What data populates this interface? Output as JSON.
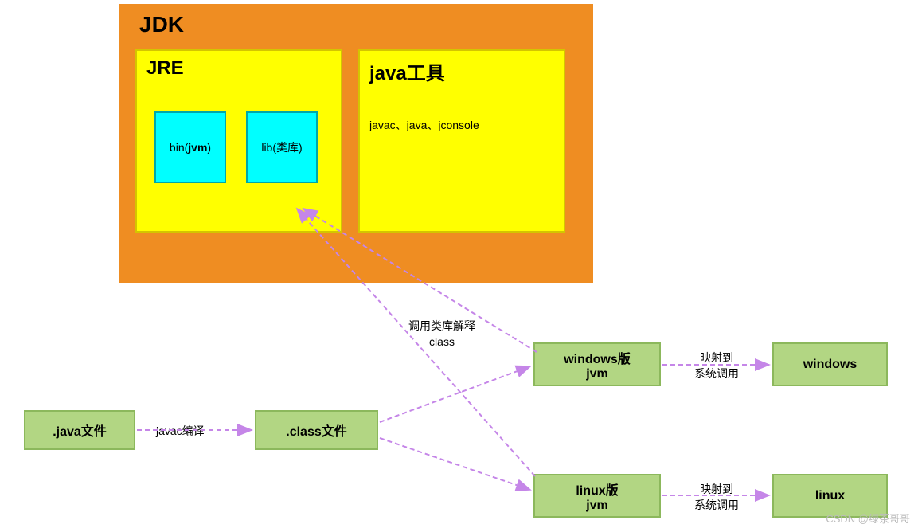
{
  "jdk": {
    "title": "JDK",
    "jre": {
      "title": "JRE",
      "bin_prefix": "bin(",
      "bin_bold": "jvm",
      "bin_suffix": ")",
      "lib": "lib(类库)"
    },
    "tools": {
      "title": "java工具",
      "list": "javac、java、jconsole"
    }
  },
  "labels": {
    "call_lib": "调用类库解释\nclass",
    "javac": "javac编译",
    "map_sys1": "映射到\n系统调用",
    "map_sys2": "映射到\n系统调用"
  },
  "boxes": {
    "java_file": ".java文件",
    "class_file": ".class文件",
    "win_jvm_l1": "windows版",
    "win_jvm_l2": "jvm",
    "linux_jvm_l1": "linux版",
    "linux_jvm_l2": "jvm",
    "windows": "windows",
    "linux": "linux"
  },
  "watermark": "CSDN @绿茶哥哥"
}
